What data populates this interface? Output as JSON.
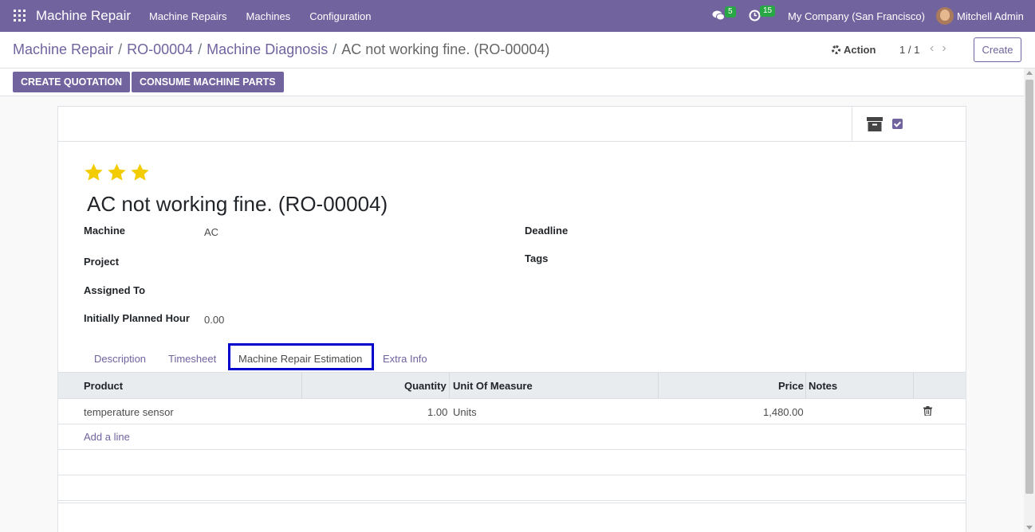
{
  "navbar": {
    "brand": "Machine Repair",
    "menu": [
      "Machine Repairs",
      "Machines",
      "Configuration"
    ],
    "chat_count": "5",
    "activity_count": "15",
    "company": "My Company (San Francisco)",
    "user": "Mitchell Admin",
    "accent": "#71639e"
  },
  "breadcrumb": {
    "items": [
      "Machine Repair",
      "RO-00004",
      "Machine Diagnosis"
    ],
    "current": "AC not working fine. (RO-00004)"
  },
  "toolbar": {
    "action_label": "Action",
    "pager": "1 / 1",
    "create_label": "Create"
  },
  "status_buttons": {
    "create_quotation": "CREATE QUOTATION",
    "consume_parts": "CONSUME MACHINE PARTS"
  },
  "record": {
    "priority_stars": 3,
    "title": "AC not working fine. (RO-00004)",
    "fields": {
      "machine_label": "Machine",
      "machine_value": "AC",
      "project_label": "Project",
      "assigned_label": "Assigned To",
      "planned_label": "Initially Planned Hour",
      "planned_value": "0.00",
      "deadline_label": "Deadline",
      "tags_label": "Tags"
    }
  },
  "tabs": {
    "description": "Description",
    "timesheet": "Timesheet",
    "estimation": "Machine Repair Estimation",
    "extra_info": "Extra Info",
    "active": "Machine Repair Estimation"
  },
  "table": {
    "headers": {
      "product": "Product",
      "quantity": "Quantity",
      "uom": "Unit Of Measure",
      "price": "Price",
      "notes": "Notes"
    },
    "rows": [
      {
        "product": "temperature sensor",
        "quantity": "1.00",
        "uom": "Units",
        "price": "1,480.00",
        "notes": ""
      }
    ],
    "add_line": "Add a line"
  }
}
